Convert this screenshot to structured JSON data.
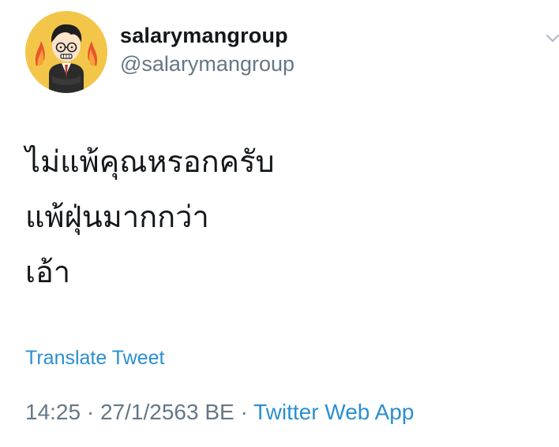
{
  "author": {
    "display_name": "salarymangroup",
    "handle": "@salarymangroup",
    "avatar_icon": "cartoon-salaryman-avatar"
  },
  "tweet": {
    "lines": [
      "ไม่แพ้คุณหรอกครับ",
      "แพ้ฝุ่นมากกว่า",
      "เอ้า"
    ]
  },
  "translate_label": "Translate Tweet",
  "meta": {
    "time": "14:25",
    "separator1": " · ",
    "date": "27/1/2563 BE",
    "separator2": " · ",
    "source": "Twitter Web App"
  },
  "colors": {
    "link": "#2a8fd1",
    "secondary_text": "#657786",
    "primary_text": "#14171a",
    "avatar_background": "#f3c64a"
  }
}
